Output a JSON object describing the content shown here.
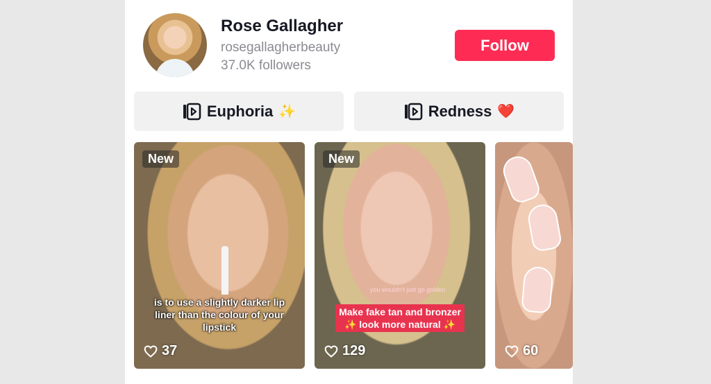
{
  "profile": {
    "name": "Rose Gallagher",
    "handle": "rosegallagherbeauty",
    "followers": "37.0K followers",
    "follow_label": "Follow"
  },
  "playlists": [
    {
      "label": "Euphoria",
      "emoji": "✨"
    },
    {
      "label": "Redness",
      "emoji": "❤️"
    }
  ],
  "videos": [
    {
      "badge": "New",
      "caption": "is to use a slightly darker lip liner than the colour of your lipstick",
      "likes": "37"
    },
    {
      "badge": "New",
      "caption_top": "you wouldn't just go golden",
      "caption": "Make fake tan and bronzer ✨ look more natural ✨",
      "likes": "129"
    },
    {
      "likes": "60"
    }
  ],
  "colors": {
    "accent": "#fe2c55",
    "text_primary": "#161823",
    "text_secondary": "#8a8b91"
  },
  "icons": {
    "playlist": "playlist-icon",
    "likes": "heart-outline-icon"
  }
}
